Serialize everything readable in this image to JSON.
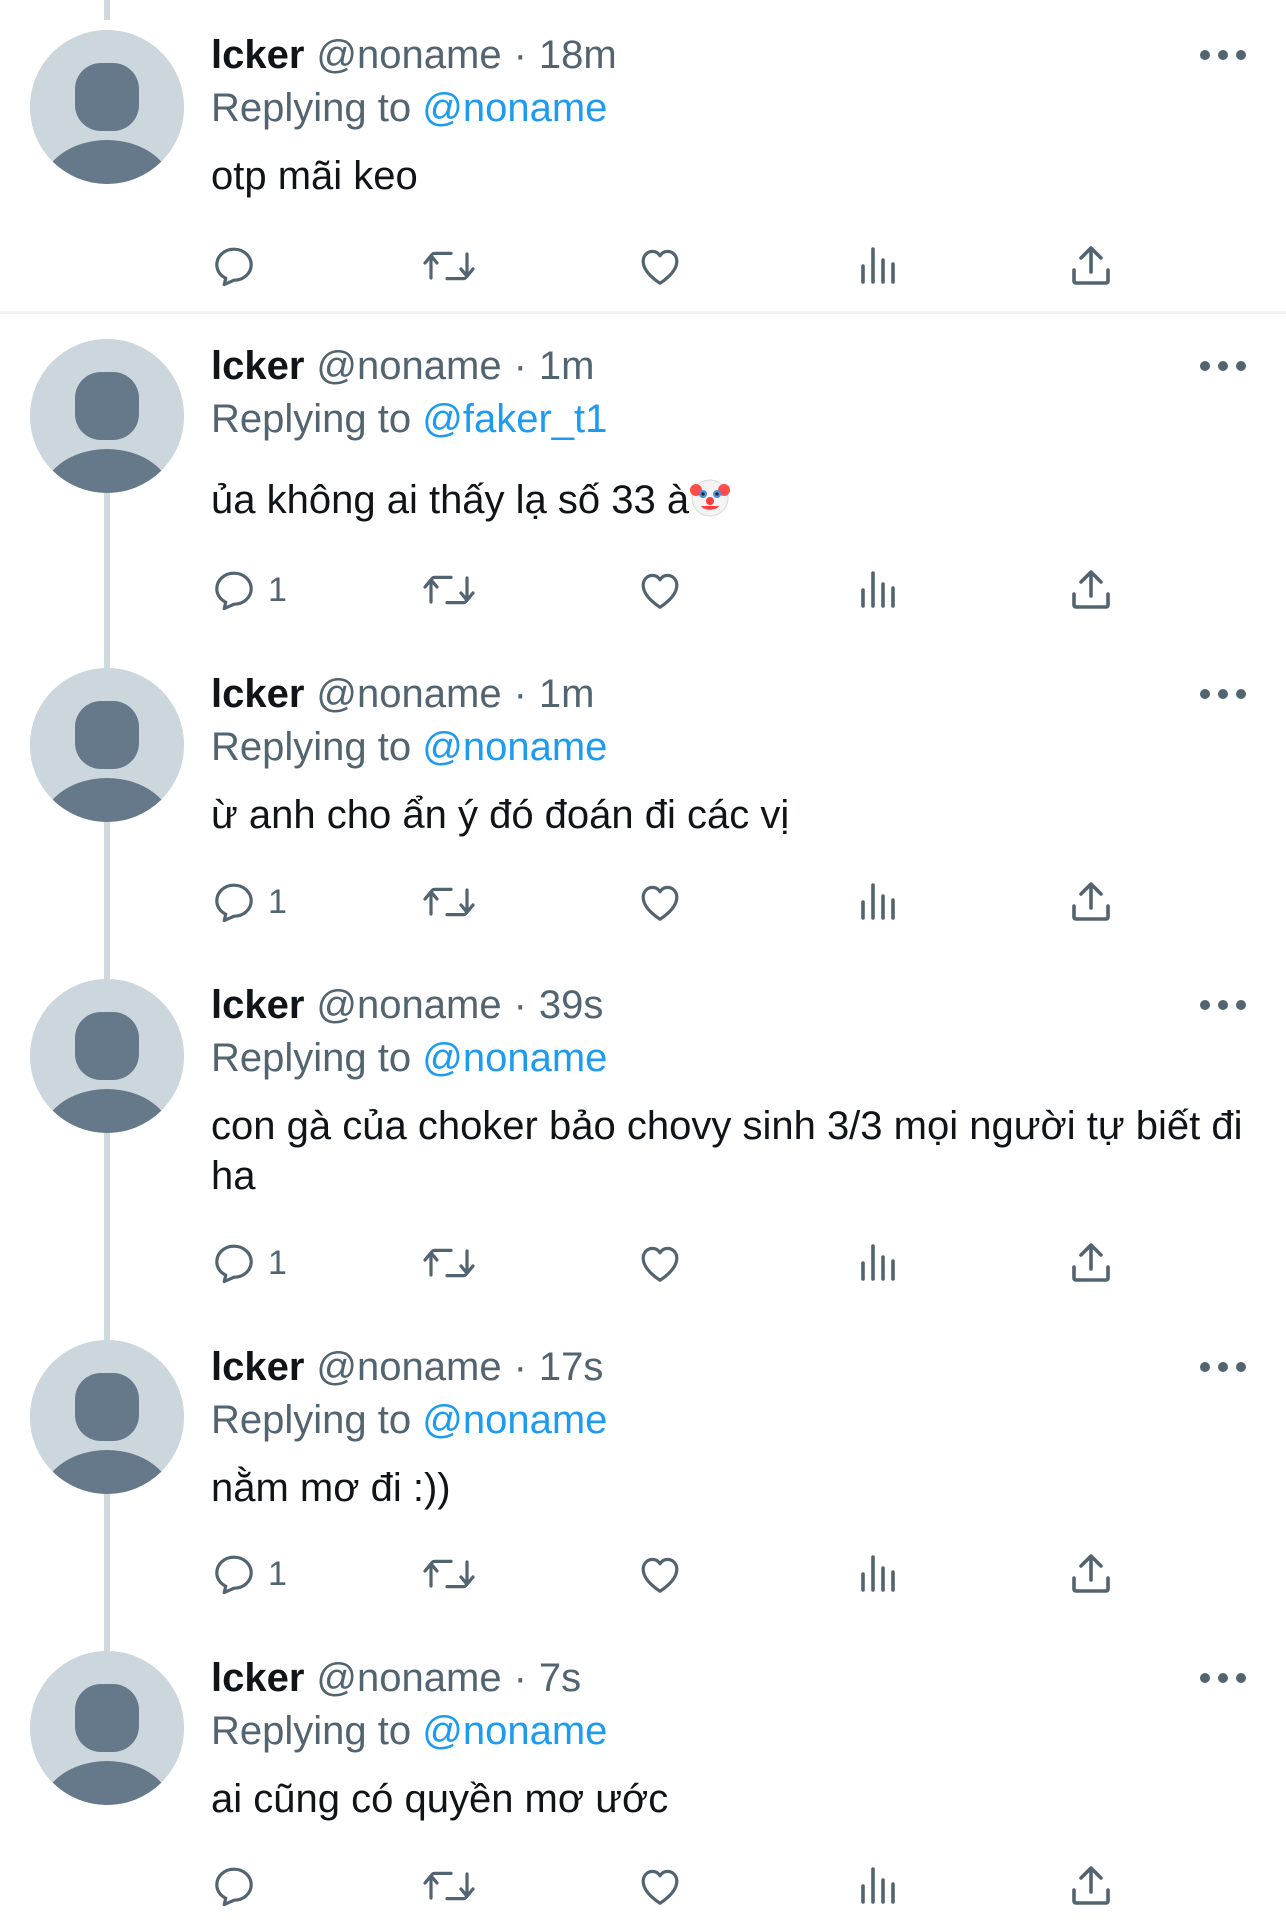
{
  "tweets": [
    {
      "name": "lcker",
      "handle": "@noname",
      "dot": "·",
      "time": "18m",
      "reply_prefix": "Replying to",
      "reply_to": "@noname",
      "text": "otp mãi keo",
      "reply_count": ""
    },
    {
      "name": "lcker",
      "handle": "@noname",
      "dot": "·",
      "time": "1m",
      "reply_prefix": "Replying to",
      "reply_to": "@faker_t1",
      "text": "ủa không ai thấy lạ số 33 à",
      "emoji": "clown-face",
      "reply_count": "1"
    },
    {
      "name": "lcker",
      "handle": "@noname",
      "dot": "·",
      "time": "1m",
      "reply_prefix": "Replying to",
      "reply_to": "@noname",
      "text": "ừ anh cho ẩn ý đó đoán đi các vị",
      "reply_count": "1"
    },
    {
      "name": "lcker",
      "handle": "@noname",
      "dot": "·",
      "time": "39s",
      "reply_prefix": "Replying to",
      "reply_to": "@noname",
      "text": "con gà của choker bảo chovy sinh 3/3 mọi người tự biết đi ha",
      "reply_count": "1"
    },
    {
      "name": "lcker",
      "handle": "@noname",
      "dot": "·",
      "time": "17s",
      "reply_prefix": "Replying to",
      "reply_to": "@noname",
      "text": "nằm mơ đi :))",
      "reply_count": "1"
    },
    {
      "name": "lcker",
      "handle": "@noname",
      "dot": "·",
      "time": "7s",
      "reply_prefix": "Replying to",
      "reply_to": "@noname",
      "text": "ai cũng có quyền mơ ước",
      "reply_count": ""
    }
  ],
  "icons": {
    "reply": "reply-icon",
    "retweet": "retweet-icon",
    "like": "heart-icon",
    "views": "views-icon",
    "share": "share-icon",
    "more": "more-icon",
    "avatar": "default-avatar-icon"
  },
  "colors": {
    "text": "#0f1419",
    "secondary": "#536471",
    "link": "#1d9bf0",
    "avatar_bg": "#ccd6dd",
    "avatar_fg": "#66798a",
    "thread_line": "#cfd9de"
  }
}
